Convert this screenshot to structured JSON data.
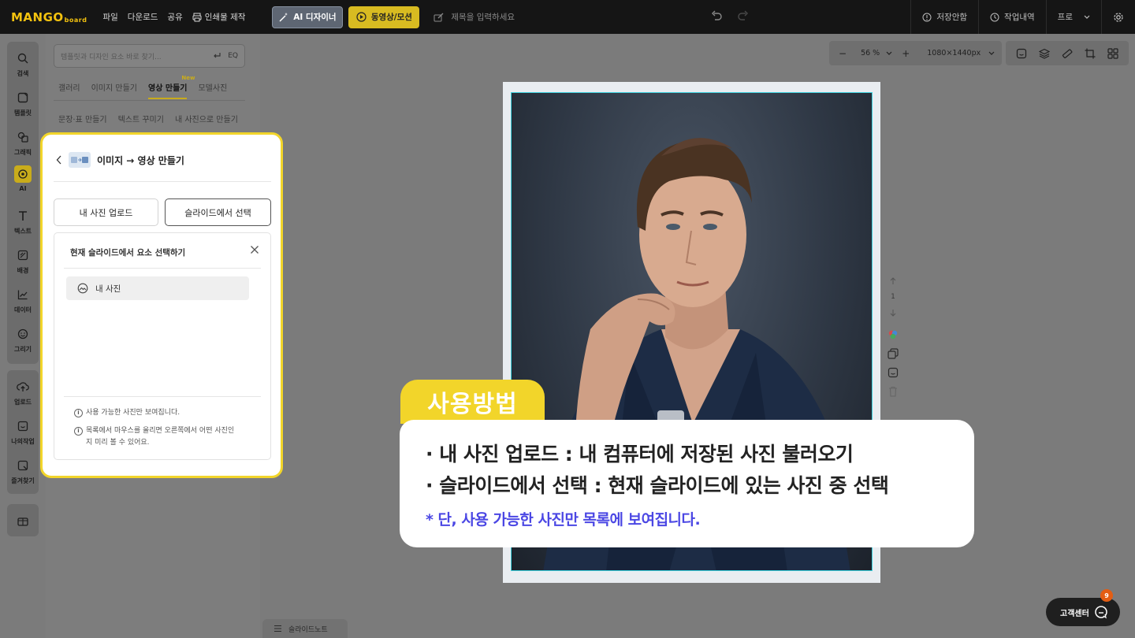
{
  "topbar": {
    "logo": "MANGO",
    "logo_sub": "board",
    "menu": [
      "파일",
      "다운로드",
      "공유",
      "인쇄물 제작"
    ],
    "ai_designer": "AI 디자이너",
    "video_motion": "동영상/모션",
    "title_placeholder": "제목을 입력하세요",
    "not_saved": "저장안함",
    "history": "작업내역",
    "plan": "프로"
  },
  "rail": {
    "items": [
      "검색",
      "템플릿",
      "그래픽",
      "AI",
      "텍스트",
      "배경",
      "데이터",
      "그리기"
    ],
    "items2": [
      "업로드",
      "나의작업",
      "즐겨찾기"
    ]
  },
  "panel": {
    "search_placeholder": "템플릿과 디자인 요소 바로 찾기...",
    "search_icon_label": "EQ",
    "tabs": [
      "갤러리",
      "이미지 만들기",
      "영상 만들기",
      "모델사진"
    ],
    "new_badge": "New",
    "subtabs": [
      "문장·표 만들기",
      "텍스트 꾸미기",
      "내 사진으로 만들기"
    ]
  },
  "popup": {
    "title": "이미지 → 영상 만들기",
    "upload_btn": "내 사진 업로드",
    "select_btn": "슬라이드에서 선택",
    "box_title": "현재 슬라이드에서 요소 선택하기",
    "my_photo": "내 사진",
    "note1": "사용 가능한 사진만 보여집니다.",
    "note2": "목록에서 마우스를 올리면 오른쪽에서 어떤 사진인지 미리 볼 수 있어요."
  },
  "canvas": {
    "zoom_minus": "−",
    "zoom": "56 %",
    "zoom_plus": "+",
    "size": "1080×1440px",
    "page_number": "1"
  },
  "overlay": {
    "badge": "사용방법",
    "line1": "· 내 사진 업로드 : 내 컴퓨터에 저장된 사진 불러오기",
    "line2": "· 슬라이드에서 선택 : 현재 슬라이드에 있는 사진 중 선택",
    "line3": "* 단, 사용 가능한 사진만 목록에 보여집니다."
  },
  "bottom": {
    "slide_note": "슬라이드노트",
    "customer_center": "고객센터",
    "cs_count": "9"
  },
  "colors": {
    "accent_yellow": "#f2d52a",
    "note_purple": "#4b47e4",
    "selection_cyan": "#3ed3e0"
  }
}
